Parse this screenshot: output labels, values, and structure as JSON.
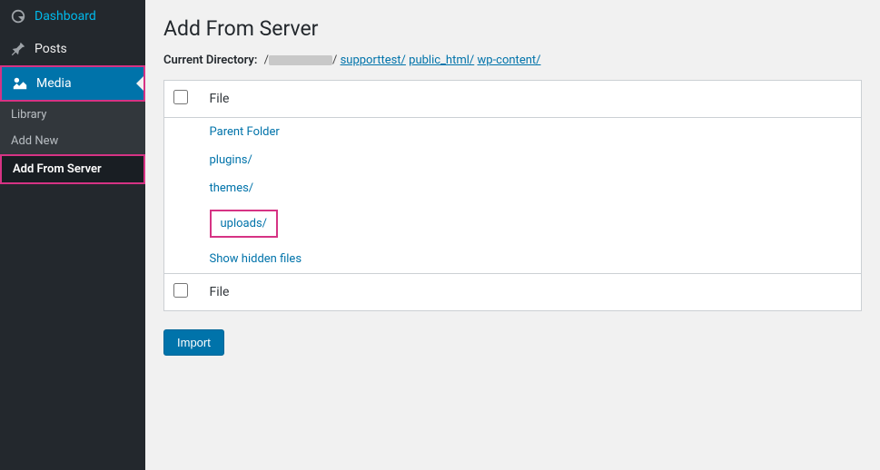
{
  "sidebar": {
    "dashboard": "Dashboard",
    "posts": "Posts",
    "media": "Media",
    "submenu": {
      "library": "Library",
      "add_new": "Add New",
      "add_from_server": "Add From Server"
    }
  },
  "page": {
    "title": "Add From Server",
    "current_dir_label": "Current Directory:",
    "breadcrumb": {
      "supporttest": "supporttest/",
      "public_html": "public_html/",
      "wp_content": "wp-content/"
    }
  },
  "table": {
    "col_file": "File",
    "rows": {
      "parent": "Parent Folder",
      "plugins": "plugins/",
      "themes": "themes/",
      "uploads": "uploads/",
      "show_hidden": "Show hidden files"
    }
  },
  "actions": {
    "import": "Import"
  }
}
